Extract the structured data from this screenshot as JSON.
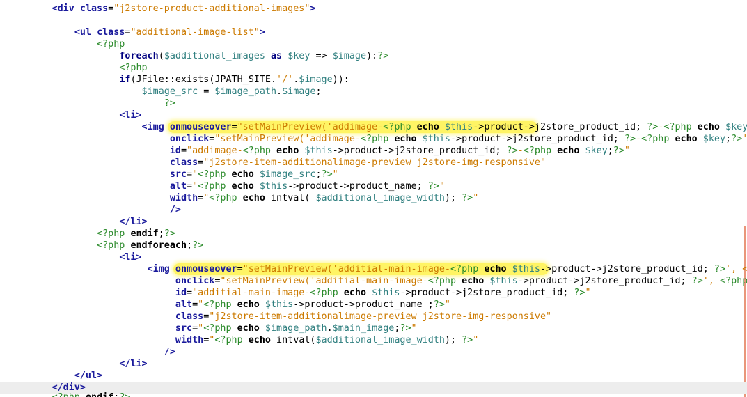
{
  "editor": {
    "language": "php",
    "colors": {
      "tag": "#1a1a9c",
      "string": "#cc7a00",
      "php_delimiter": "#2a8a2a",
      "variable": "#2f7f7f",
      "highlight": "#fff028",
      "current_line": "#ededed",
      "margin_guide": "#c8e6c8",
      "gutter_mark": "#e9967a"
    },
    "current_line_index": 32,
    "lines": [
      {
        "indent": 9,
        "tokens": [
          [
            "tag",
            "<div "
          ],
          [
            "attr",
            "class"
          ],
          [
            "pun",
            "="
          ],
          [
            "str",
            "\"j2store-product-additional-images\""
          ],
          [
            "tag",
            ">"
          ]
        ]
      },
      {
        "indent": 0,
        "tokens": []
      },
      {
        "indent": 13,
        "tokens": [
          [
            "tag",
            "<ul "
          ],
          [
            "attr",
            "class"
          ],
          [
            "pun",
            "="
          ],
          [
            "str",
            "\"additional-image-list\""
          ],
          [
            "tag",
            ">"
          ]
        ]
      },
      {
        "indent": 17,
        "tokens": [
          [
            "php",
            "<?php"
          ]
        ]
      },
      {
        "indent": 21,
        "tokens": [
          [
            "kw",
            "foreach"
          ],
          [
            "pun",
            "("
          ],
          [
            "var",
            "$additional_images"
          ],
          [
            "txt",
            " "
          ],
          [
            "kw",
            "as"
          ],
          [
            "txt",
            " "
          ],
          [
            "var",
            "$key"
          ],
          [
            "txt",
            " => "
          ],
          [
            "var",
            "$image"
          ],
          [
            "pun",
            "):"
          ],
          [
            "php",
            "?>"
          ]
        ]
      },
      {
        "indent": 21,
        "tokens": [
          [
            "php",
            "<?php"
          ]
        ]
      },
      {
        "indent": 21,
        "tokens": [
          [
            "kw",
            "if"
          ],
          [
            "pun",
            "("
          ],
          [
            "txt",
            "JFile::exists(JPATH_SITE."
          ],
          [
            "str",
            "'/'"
          ],
          [
            "txt",
            "."
          ],
          [
            "var",
            "$image"
          ],
          [
            "txt",
            "))"
          ],
          [
            "pun",
            ":"
          ]
        ]
      },
      {
        "indent": 25,
        "tokens": [
          [
            "var",
            "$image_src"
          ],
          [
            "txt",
            " = "
          ],
          [
            "var",
            "$image_path"
          ],
          [
            "txt",
            "."
          ],
          [
            "var",
            "$image"
          ],
          [
            "txt",
            ";"
          ]
        ]
      },
      {
        "indent": 29,
        "tokens": [
          [
            "php",
            "?>"
          ]
        ]
      },
      {
        "indent": 21,
        "tokens": [
          [
            "tag",
            "<li>"
          ]
        ]
      },
      {
        "indent": 25,
        "highlight": [
          30,
          95
        ],
        "tokens": [
          [
            "tag",
            "<img "
          ],
          [
            "attr",
            "onmouseover"
          ],
          [
            "pun",
            "="
          ],
          [
            "str",
            "\"setMainPreview('addimage-"
          ],
          [
            "php",
            "<?php"
          ],
          [
            "txt",
            " "
          ],
          [
            "bold",
            "echo"
          ],
          [
            "txt",
            " "
          ],
          [
            "var",
            "$this"
          ],
          [
            "txt",
            "->product->j2store_product_id; "
          ],
          [
            "php",
            "?>"
          ],
          [
            "str",
            "-"
          ],
          [
            "php",
            "<?php"
          ],
          [
            "txt",
            " "
          ],
          [
            "bold",
            "echo"
          ],
          [
            "txt",
            " "
          ],
          [
            "var",
            "$key"
          ],
          [
            "txt",
            ";"
          ]
        ]
      },
      {
        "indent": 30,
        "tokens": [
          [
            "attr",
            "onclick"
          ],
          [
            "pun",
            "="
          ],
          [
            "str",
            "\"setMainPreview('addimage-"
          ],
          [
            "php",
            "<?php"
          ],
          [
            "txt",
            " "
          ],
          [
            "bold",
            "echo"
          ],
          [
            "txt",
            " "
          ],
          [
            "var",
            "$this"
          ],
          [
            "txt",
            "->product->j2store_product_id; "
          ],
          [
            "php",
            "?>"
          ],
          [
            "str",
            "-"
          ],
          [
            "php",
            "<?php"
          ],
          [
            "txt",
            " "
          ],
          [
            "bold",
            "echo"
          ],
          [
            "txt",
            " "
          ],
          [
            "var",
            "$key"
          ],
          [
            "txt",
            ";"
          ],
          [
            "php",
            "?>"
          ],
          [
            "str",
            "',"
          ]
        ]
      },
      {
        "indent": 30,
        "tokens": [
          [
            "attr",
            "id"
          ],
          [
            "pun",
            "="
          ],
          [
            "str",
            "\"addimage-"
          ],
          [
            "php",
            "<?php"
          ],
          [
            "txt",
            " "
          ],
          [
            "bold",
            "echo"
          ],
          [
            "txt",
            " "
          ],
          [
            "var",
            "$this"
          ],
          [
            "txt",
            "->product->j2store_product_id; "
          ],
          [
            "php",
            "?>"
          ],
          [
            "str",
            "-"
          ],
          [
            "php",
            "<?php"
          ],
          [
            "txt",
            " "
          ],
          [
            "bold",
            "echo"
          ],
          [
            "txt",
            " "
          ],
          [
            "var",
            "$key"
          ],
          [
            "txt",
            ";"
          ],
          [
            "php",
            "?>"
          ],
          [
            "str",
            "\""
          ]
        ]
      },
      {
        "indent": 30,
        "tokens": [
          [
            "attr",
            "class"
          ],
          [
            "pun",
            "="
          ],
          [
            "str",
            "\"j2store-item-additionalimage-preview j2store-img-responsive\""
          ]
        ]
      },
      {
        "indent": 30,
        "tokens": [
          [
            "attr",
            "src"
          ],
          [
            "pun",
            "="
          ],
          [
            "str",
            "\""
          ],
          [
            "php",
            "<?php"
          ],
          [
            "txt",
            " "
          ],
          [
            "bold",
            "echo"
          ],
          [
            "txt",
            " "
          ],
          [
            "var",
            "$image_src"
          ],
          [
            "txt",
            ";"
          ],
          [
            "php",
            "?>"
          ],
          [
            "str",
            "\""
          ]
        ]
      },
      {
        "indent": 30,
        "tokens": [
          [
            "attr",
            "alt"
          ],
          [
            "pun",
            "="
          ],
          [
            "str",
            "\""
          ],
          [
            "php",
            "<?php"
          ],
          [
            "txt",
            " "
          ],
          [
            "bold",
            "echo"
          ],
          [
            "txt",
            " "
          ],
          [
            "var",
            "$this"
          ],
          [
            "txt",
            "->product->product_name; "
          ],
          [
            "php",
            "?>"
          ],
          [
            "str",
            "\""
          ]
        ]
      },
      {
        "indent": 30,
        "tokens": [
          [
            "attr",
            "width"
          ],
          [
            "pun",
            "="
          ],
          [
            "str",
            "\""
          ],
          [
            "php",
            "<?php"
          ],
          [
            "txt",
            " "
          ],
          [
            "bold",
            "echo"
          ],
          [
            "txt",
            " intval( "
          ],
          [
            "var",
            "$additional_image_width"
          ],
          [
            "txt",
            "); "
          ],
          [
            "php",
            "?>"
          ],
          [
            "str",
            "\""
          ]
        ]
      },
      {
        "indent": 30,
        "tokens": [
          [
            "tag",
            "/>"
          ]
        ]
      },
      {
        "indent": 21,
        "tokens": [
          [
            "tag",
            "</li>"
          ]
        ]
      },
      {
        "indent": 17,
        "tokens": [
          [
            "php",
            "<?php"
          ],
          [
            "txt",
            " "
          ],
          [
            "bold",
            "endif"
          ],
          [
            "txt",
            ";"
          ],
          [
            "php",
            "?>"
          ]
        ]
      },
      {
        "indent": 17,
        "tokens": [
          [
            "php",
            "<?php"
          ],
          [
            "txt",
            " "
          ],
          [
            "bold",
            "endforeach"
          ],
          [
            "txt",
            ";"
          ],
          [
            "php",
            "?>"
          ]
        ]
      },
      {
        "indent": 21,
        "tokens": [
          [
            "tag",
            "<li>"
          ]
        ]
      },
      {
        "indent": 26,
        "highlight": [
          31,
          97
        ],
        "tokens": [
          [
            "tag",
            "<img "
          ],
          [
            "attr",
            "onmouseover"
          ],
          [
            "pun",
            "="
          ],
          [
            "str",
            "\"setMainPreview('additial-main-image-"
          ],
          [
            "php",
            "<?php"
          ],
          [
            "txt",
            " "
          ],
          [
            "bold",
            "echo"
          ],
          [
            "txt",
            " "
          ],
          [
            "var",
            "$this"
          ],
          [
            "txt",
            "->product->j2store_product_id; "
          ],
          [
            "php",
            "?>"
          ],
          [
            "str",
            "', <"
          ]
        ]
      },
      {
        "indent": 31,
        "tokens": [
          [
            "attr",
            "onclick"
          ],
          [
            "pun",
            "="
          ],
          [
            "str",
            "\"setMainPreview('additial-main-image-"
          ],
          [
            "php",
            "<?php"
          ],
          [
            "txt",
            " "
          ],
          [
            "bold",
            "echo"
          ],
          [
            "txt",
            " "
          ],
          [
            "var",
            "$this"
          ],
          [
            "txt",
            "->product->j2store_product_id; "
          ],
          [
            "php",
            "?>"
          ],
          [
            "str",
            "', "
          ],
          [
            "php",
            "<?php"
          ]
        ]
      },
      {
        "indent": 31,
        "tokens": [
          [
            "attr",
            "id"
          ],
          [
            "pun",
            "="
          ],
          [
            "str",
            "\"additial-main-image-"
          ],
          [
            "php",
            "<?php"
          ],
          [
            "txt",
            " "
          ],
          [
            "bold",
            "echo"
          ],
          [
            "txt",
            " "
          ],
          [
            "var",
            "$this"
          ],
          [
            "txt",
            "->product->j2store_product_id; "
          ],
          [
            "php",
            "?>"
          ],
          [
            "str",
            "\""
          ]
        ]
      },
      {
        "indent": 31,
        "tokens": [
          [
            "attr",
            "alt"
          ],
          [
            "pun",
            "="
          ],
          [
            "str",
            "\""
          ],
          [
            "php",
            "<?php"
          ],
          [
            "txt",
            " "
          ],
          [
            "bold",
            "echo"
          ],
          [
            "txt",
            " "
          ],
          [
            "var",
            "$this"
          ],
          [
            "txt",
            "->product->product_name ;"
          ],
          [
            "php",
            "?>"
          ],
          [
            "str",
            "\""
          ]
        ]
      },
      {
        "indent": 31,
        "tokens": [
          [
            "attr",
            "class"
          ],
          [
            "pun",
            "="
          ],
          [
            "str",
            "\"j2store-item-additionalimage-preview j2store-img-responsive\""
          ]
        ]
      },
      {
        "indent": 31,
        "tokens": [
          [
            "attr",
            "src"
          ],
          [
            "pun",
            "="
          ],
          [
            "str",
            "\""
          ],
          [
            "php",
            "<?php"
          ],
          [
            "txt",
            " "
          ],
          [
            "bold",
            "echo"
          ],
          [
            "txt",
            " "
          ],
          [
            "var",
            "$image_path"
          ],
          [
            "txt",
            "."
          ],
          [
            "var",
            "$main_image"
          ],
          [
            "txt",
            ";"
          ],
          [
            "php",
            "?>"
          ],
          [
            "str",
            "\""
          ]
        ]
      },
      {
        "indent": 31,
        "tokens": [
          [
            "attr",
            "width"
          ],
          [
            "pun",
            "="
          ],
          [
            "str",
            "\""
          ],
          [
            "php",
            "<?php"
          ],
          [
            "txt",
            " "
          ],
          [
            "bold",
            "echo"
          ],
          [
            "txt",
            " intval("
          ],
          [
            "var",
            "$additional_image_width"
          ],
          [
            "txt",
            "); "
          ],
          [
            "php",
            "?>"
          ],
          [
            "str",
            "\""
          ]
        ]
      },
      {
        "indent": 29,
        "tokens": [
          [
            "tag",
            "/>"
          ]
        ]
      },
      {
        "indent": 21,
        "tokens": [
          [
            "tag",
            "</li>"
          ]
        ]
      },
      {
        "indent": 13,
        "tokens": [
          [
            "tag",
            "</ul>"
          ]
        ]
      },
      {
        "indent": 9,
        "caret": true,
        "tokens": [
          [
            "tag",
            "</div>"
          ]
        ]
      }
    ],
    "clipped_line": {
      "indent": 9,
      "tokens": [
        [
          "php",
          "<?php"
        ],
        [
          "txt",
          " "
        ],
        [
          "bold",
          "endif"
        ],
        [
          "txt",
          ";"
        ],
        [
          "php",
          "?>"
        ]
      ]
    }
  }
}
